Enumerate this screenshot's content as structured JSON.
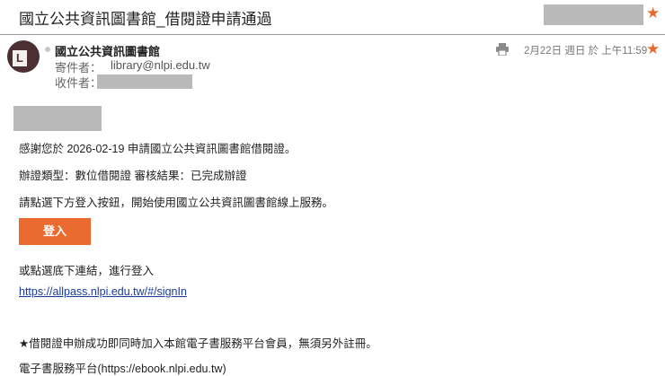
{
  "subject": "國立公共資訊圖書館_借閱證申請通過",
  "header": {
    "sender_name": "國立公共資訊圖書館",
    "from_label": "寄件者：",
    "from_value": "library@nlpi.edu.tw",
    "to_label": "收件者：",
    "avatar_letter": "L",
    "date": "2月22日 週日 於 上午11:59",
    "star_icon": "★"
  },
  "body": {
    "line1": "感謝您於 2026-02-19 申請國立公共資訊圖書館借閱證。",
    "line2": "辦證類型：數位借閱證 審核結果：已完成辦證",
    "line3": "請點選下方登入按鈕，開始使用國立公共資訊圖書館線上服務。",
    "login_button": "登入",
    "line4": "或點選底下連結，進行登入",
    "link": "https://allpass.nlpi.edu.tw/#/signIn",
    "line5": "★借閱證申辦成功即同時加入本館電子書服務平台會員，無須另外註冊。",
    "line6": "電子書服務平台(https://ebook.nlpi.edu.tw)"
  },
  "colors": {
    "accent": "#ea6a2f",
    "link": "#1a3a9c",
    "redaction": "#b9b9b9"
  }
}
